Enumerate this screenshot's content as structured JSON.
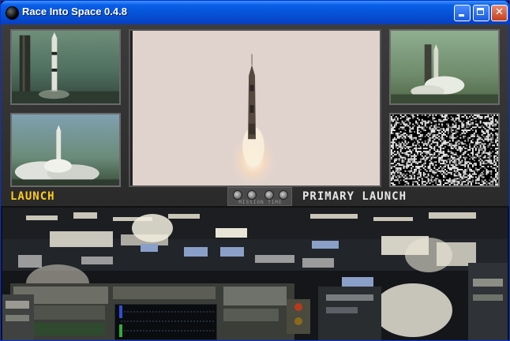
{
  "window": {
    "title": "Race Into Space 0.4.8",
    "controls": [
      "minimize",
      "maximize",
      "close"
    ]
  },
  "screen": {
    "left_label": "LAUNCH",
    "right_label": "PRIMARY LAUNCH",
    "mission_time_label": "MISSION TIME"
  },
  "feeds": [
    "launch-pad-camera-1",
    "launch-pad-camera-2",
    "main-liftoff-view",
    "launch-tower-camera",
    "no-signal-static"
  ],
  "colors": {
    "launch_label": "#ffcc1a",
    "primary_label": "#e6e6e6",
    "titlebar": "#0553d6"
  }
}
